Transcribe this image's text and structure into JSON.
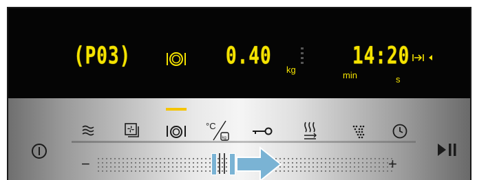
{
  "display": {
    "program": "(P03)",
    "weight_value": "0.40",
    "weight_unit": "kg",
    "time_value": "14:20",
    "time_unit_min": "min",
    "time_unit_s": "s"
  },
  "buttons": {
    "power_icon": "power-icon",
    "play_pause_icon": "play-pause-icon"
  },
  "function_icons": [
    {
      "name": "heating-mode-icon",
      "active": false
    },
    {
      "name": "fan-program-icon",
      "active": false
    },
    {
      "name": "dish-program-icon",
      "active": true
    },
    {
      "name": "temperature-weight-icon",
      "active": false
    },
    {
      "name": "lock-key-icon",
      "active": false
    },
    {
      "name": "fast-preheat-icon",
      "active": false
    },
    {
      "name": "sensor-program-icon",
      "active": false
    },
    {
      "name": "timer-clock-icon",
      "active": false
    }
  ],
  "slider": {
    "minus": "−",
    "plus": "+",
    "arrow_color": "#7ab3d4"
  },
  "colors": {
    "display_text": "#f5e300",
    "active_indicator": "#f5c400"
  }
}
